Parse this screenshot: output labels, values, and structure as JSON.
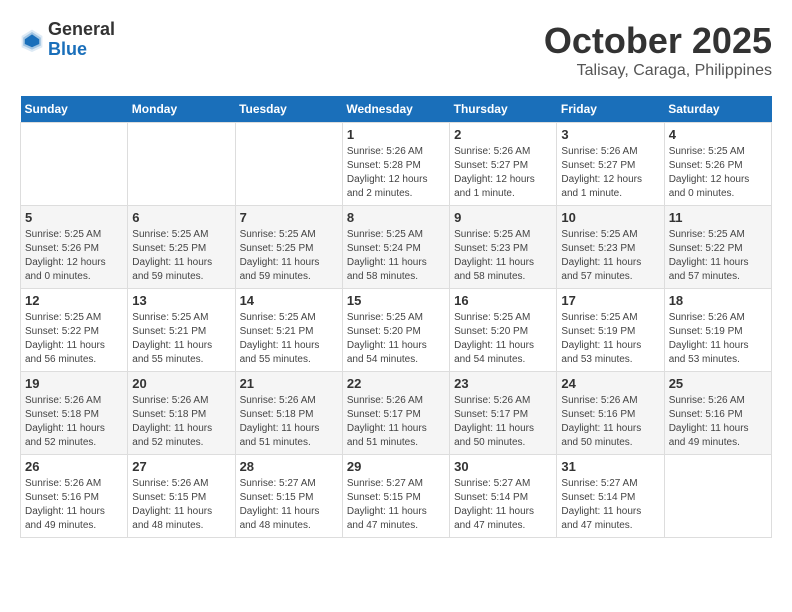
{
  "logo": {
    "general": "General",
    "blue": "Blue"
  },
  "title": "October 2025",
  "location": "Talisay, Caraga, Philippines",
  "weekdays": [
    "Sunday",
    "Monday",
    "Tuesday",
    "Wednesday",
    "Thursday",
    "Friday",
    "Saturday"
  ],
  "weeks": [
    [
      {
        "day": "",
        "info": ""
      },
      {
        "day": "",
        "info": ""
      },
      {
        "day": "",
        "info": ""
      },
      {
        "day": "1",
        "info": "Sunrise: 5:26 AM\nSunset: 5:28 PM\nDaylight: 12 hours\nand 2 minutes."
      },
      {
        "day": "2",
        "info": "Sunrise: 5:26 AM\nSunset: 5:27 PM\nDaylight: 12 hours\nand 1 minute."
      },
      {
        "day": "3",
        "info": "Sunrise: 5:26 AM\nSunset: 5:27 PM\nDaylight: 12 hours\nand 1 minute."
      },
      {
        "day": "4",
        "info": "Sunrise: 5:25 AM\nSunset: 5:26 PM\nDaylight: 12 hours\nand 0 minutes."
      }
    ],
    [
      {
        "day": "5",
        "info": "Sunrise: 5:25 AM\nSunset: 5:26 PM\nDaylight: 12 hours\nand 0 minutes."
      },
      {
        "day": "6",
        "info": "Sunrise: 5:25 AM\nSunset: 5:25 PM\nDaylight: 11 hours\nand 59 minutes."
      },
      {
        "day": "7",
        "info": "Sunrise: 5:25 AM\nSunset: 5:25 PM\nDaylight: 11 hours\nand 59 minutes."
      },
      {
        "day": "8",
        "info": "Sunrise: 5:25 AM\nSunset: 5:24 PM\nDaylight: 11 hours\nand 58 minutes."
      },
      {
        "day": "9",
        "info": "Sunrise: 5:25 AM\nSunset: 5:23 PM\nDaylight: 11 hours\nand 58 minutes."
      },
      {
        "day": "10",
        "info": "Sunrise: 5:25 AM\nSunset: 5:23 PM\nDaylight: 11 hours\nand 57 minutes."
      },
      {
        "day": "11",
        "info": "Sunrise: 5:25 AM\nSunset: 5:22 PM\nDaylight: 11 hours\nand 57 minutes."
      }
    ],
    [
      {
        "day": "12",
        "info": "Sunrise: 5:25 AM\nSunset: 5:22 PM\nDaylight: 11 hours\nand 56 minutes."
      },
      {
        "day": "13",
        "info": "Sunrise: 5:25 AM\nSunset: 5:21 PM\nDaylight: 11 hours\nand 55 minutes."
      },
      {
        "day": "14",
        "info": "Sunrise: 5:25 AM\nSunset: 5:21 PM\nDaylight: 11 hours\nand 55 minutes."
      },
      {
        "day": "15",
        "info": "Sunrise: 5:25 AM\nSunset: 5:20 PM\nDaylight: 11 hours\nand 54 minutes."
      },
      {
        "day": "16",
        "info": "Sunrise: 5:25 AM\nSunset: 5:20 PM\nDaylight: 11 hours\nand 54 minutes."
      },
      {
        "day": "17",
        "info": "Sunrise: 5:25 AM\nSunset: 5:19 PM\nDaylight: 11 hours\nand 53 minutes."
      },
      {
        "day": "18",
        "info": "Sunrise: 5:26 AM\nSunset: 5:19 PM\nDaylight: 11 hours\nand 53 minutes."
      }
    ],
    [
      {
        "day": "19",
        "info": "Sunrise: 5:26 AM\nSunset: 5:18 PM\nDaylight: 11 hours\nand 52 minutes."
      },
      {
        "day": "20",
        "info": "Sunrise: 5:26 AM\nSunset: 5:18 PM\nDaylight: 11 hours\nand 52 minutes."
      },
      {
        "day": "21",
        "info": "Sunrise: 5:26 AM\nSunset: 5:18 PM\nDaylight: 11 hours\nand 51 minutes."
      },
      {
        "day": "22",
        "info": "Sunrise: 5:26 AM\nSunset: 5:17 PM\nDaylight: 11 hours\nand 51 minutes."
      },
      {
        "day": "23",
        "info": "Sunrise: 5:26 AM\nSunset: 5:17 PM\nDaylight: 11 hours\nand 50 minutes."
      },
      {
        "day": "24",
        "info": "Sunrise: 5:26 AM\nSunset: 5:16 PM\nDaylight: 11 hours\nand 50 minutes."
      },
      {
        "day": "25",
        "info": "Sunrise: 5:26 AM\nSunset: 5:16 PM\nDaylight: 11 hours\nand 49 minutes."
      }
    ],
    [
      {
        "day": "26",
        "info": "Sunrise: 5:26 AM\nSunset: 5:16 PM\nDaylight: 11 hours\nand 49 minutes."
      },
      {
        "day": "27",
        "info": "Sunrise: 5:26 AM\nSunset: 5:15 PM\nDaylight: 11 hours\nand 48 minutes."
      },
      {
        "day": "28",
        "info": "Sunrise: 5:27 AM\nSunset: 5:15 PM\nDaylight: 11 hours\nand 48 minutes."
      },
      {
        "day": "29",
        "info": "Sunrise: 5:27 AM\nSunset: 5:15 PM\nDaylight: 11 hours\nand 47 minutes."
      },
      {
        "day": "30",
        "info": "Sunrise: 5:27 AM\nSunset: 5:14 PM\nDaylight: 11 hours\nand 47 minutes."
      },
      {
        "day": "31",
        "info": "Sunrise: 5:27 AM\nSunset: 5:14 PM\nDaylight: 11 hours\nand 47 minutes."
      },
      {
        "day": "",
        "info": ""
      }
    ]
  ]
}
